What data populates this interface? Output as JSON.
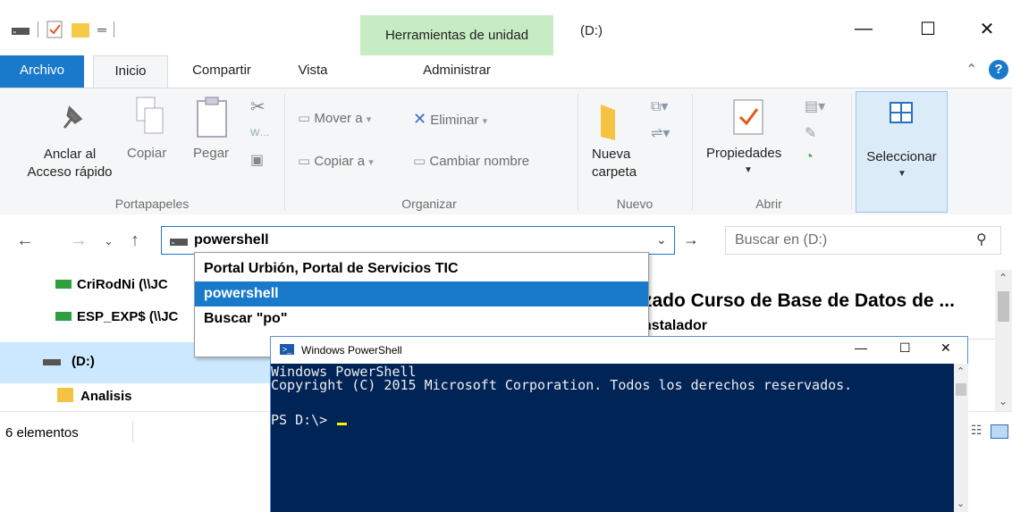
{
  "explorer": {
    "window_title": "(D:)",
    "tool_tab": "Herramientas de unidad",
    "tabs": [
      "Archivo",
      "Inicio",
      "Compartir",
      "Vista",
      "Administrar"
    ],
    "ribbon": {
      "anclar_line1": "Anclar al",
      "anclar_line2": "Acceso rápido",
      "copiar": "Copiar",
      "pegar": "Pegar",
      "mover": "Mover a",
      "copiar_a": "Copiar a",
      "eliminar": "Eliminar",
      "cambiar_nombre": "Cambiar nombre",
      "nueva_line1": "Nueva",
      "nueva_line2": "carpeta",
      "propiedades": "Propiedades",
      "seleccionar": "Seleccionar",
      "groups": [
        "Portapapeles",
        "Organizar",
        "Nuevo",
        "Abrir"
      ]
    },
    "address_value": "powershell",
    "search_placeholder": "Buscar en  (D:)",
    "nav_items": [
      "CriRodNi (\\\\JC",
      "ESP_EXP$ (\\\\JC",
      "(D:)",
      "Analisis"
    ],
    "content_title": "zado Curso de Base de Datos de ...",
    "content_sub": "nstalador",
    "status": "6 elementos"
  },
  "autocomplete": [
    "Portal Urbión, Portal de Servicios TIC",
    "powershell",
    "Buscar \"po\""
  ],
  "powershell": {
    "title": "Windows PowerShell",
    "lines": [
      "Windows PowerShell",
      "Copyright (C) 2015 Microsoft Corporation. Todos los derechos reservados.",
      "",
      "PS D:\\> "
    ]
  },
  "colors": {
    "accent": "#1979ca",
    "tool_tab": "#c7ecc3",
    "ps_bg": "#012456"
  }
}
